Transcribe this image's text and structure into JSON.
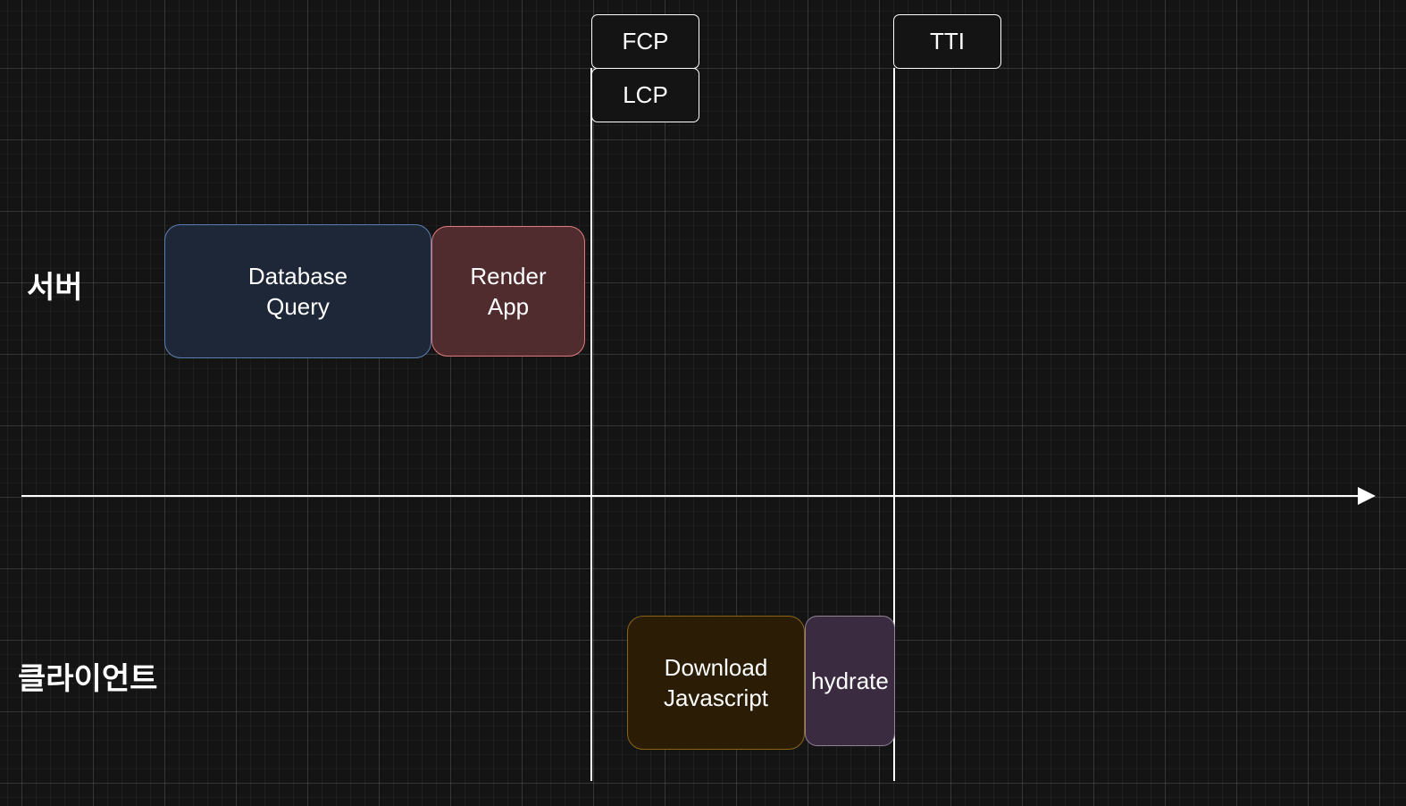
{
  "lanes": {
    "server": "서버",
    "client": "클라이언트"
  },
  "blocks": {
    "database_query": {
      "label": "Database\nQuery",
      "fill": "#1e2738",
      "stroke": "#5b7eb0"
    },
    "render_app": {
      "label": "Render\nApp",
      "fill": "#502c2f",
      "stroke": "#e07a7a"
    },
    "download_javascript": {
      "label": "Download\nJavascript",
      "fill": "#2b1d05",
      "stroke": "#8a6512"
    },
    "hydrate": {
      "label": "hydrate",
      "fill": "#3a2b40",
      "stroke": "#8f8496"
    }
  },
  "markers": {
    "fcp": "FCP",
    "lcp": "LCP",
    "tti": "TTI"
  },
  "colors": {
    "background": "#141414",
    "line": "#ffffff"
  }
}
